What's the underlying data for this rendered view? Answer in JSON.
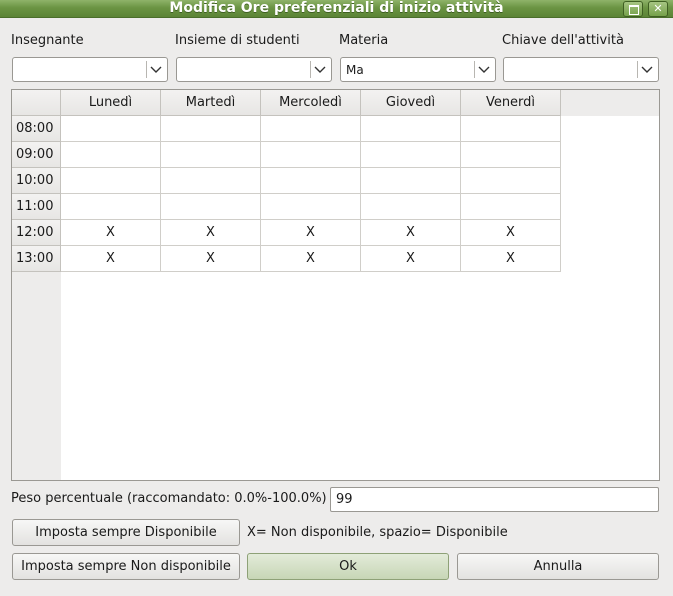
{
  "window": {
    "title": "Modifica Ore preferenziali di inizio attività"
  },
  "filters": [
    {
      "label": "Insegnante",
      "value": ""
    },
    {
      "label": "Insieme di studenti",
      "value": ""
    },
    {
      "label": "Materia",
      "value": "Ma"
    },
    {
      "label": "Chiave dell'attività",
      "value": ""
    }
  ],
  "grid": {
    "days": [
      "Lunedì",
      "Martedì",
      "Mercoledì",
      "Giovedì",
      "Venerdì"
    ],
    "hours": [
      "08:00",
      "09:00",
      "10:00",
      "11:00",
      "12:00",
      "13:00"
    ],
    "cells": [
      [
        "",
        "",
        "",
        "",
        ""
      ],
      [
        "",
        "",
        "",
        "",
        ""
      ],
      [
        "",
        "",
        "",
        "",
        ""
      ],
      [
        "",
        "",
        "",
        "",
        ""
      ],
      [
        "X",
        "X",
        "X",
        "X",
        "X"
      ],
      [
        "X",
        "X",
        "X",
        "X",
        "X"
      ]
    ]
  },
  "weight": {
    "label": "Peso percentuale (raccomandato: 0.0%-100.0%)",
    "value": "99"
  },
  "buttons": {
    "set_available": "Imposta sempre Disponibile",
    "set_unavailable": "Imposta sempre Non disponibile",
    "ok": "Ok",
    "cancel": "Annulla"
  },
  "legend": "X= Non disponibile, spazio= Disponibile",
  "colors": {
    "titlebar": "#6b9443",
    "background": "#edeceb",
    "ok_button": "#c7d6b6"
  }
}
